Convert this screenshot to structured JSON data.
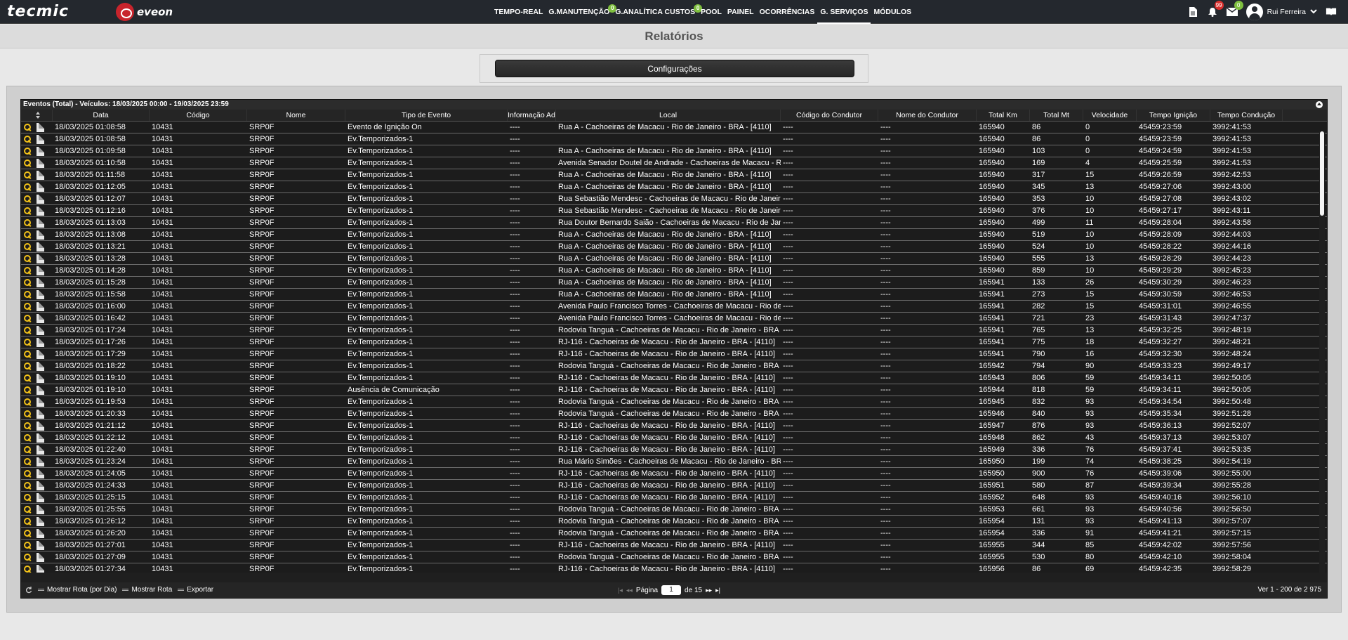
{
  "brand": {
    "tecmic": "tecmic",
    "eveon": "eveon"
  },
  "nav": [
    {
      "label": "TEMPO-REAL"
    },
    {
      "label": "G.MANUTENÇÃO",
      "badge": "0"
    },
    {
      "label": "G.ANALÍTICA CUSTOS",
      "badge": "0"
    },
    {
      "label": "POOL"
    },
    {
      "label": "PAINEL"
    },
    {
      "label": "OCORRÊNCIAS"
    },
    {
      "label": "G. SERVIÇOS",
      "active": true
    },
    {
      "label": "MÓDULOS"
    }
  ],
  "tools": {
    "alerts_badge": "99",
    "messages_badge": "0"
  },
  "user": {
    "name": "Rui Ferreira"
  },
  "page": {
    "title": "Relatórios",
    "config_button": "Configurações"
  },
  "grid": {
    "caption": "Eventos (Total) - Veículos: 18/03/2025 00:00 - 19/03/2025 23:59",
    "columns": [
      "Data",
      "Código",
      "Nome",
      "Tipo de Evento",
      "Informação Ad",
      "Local",
      "Código do Condutor",
      "Nome do Condutor",
      "Total Km",
      "Total Mt",
      "Velocidade",
      "Tempo Ignição",
      "Tempo Condução"
    ],
    "rows": [
      [
        "18/03/2025 01:08:58",
        "10431",
        "SRP0F",
        "Evento de Ignição On",
        "----",
        "Rua A - Cachoeiras de Macacu - Rio de Janeiro - BRA - [4110]",
        "----",
        "----",
        "165940",
        "86",
        "0",
        "45459:23:59",
        "3992:41:53"
      ],
      [
        "18/03/2025 01:08:58",
        "10431",
        "SRP0F",
        "Ev.Temporizados-1",
        "----",
        "",
        "----",
        "----",
        "165940",
        "86",
        "0",
        "45459:23:59",
        "3992:41:53"
      ],
      [
        "18/03/2025 01:09:58",
        "10431",
        "SRP0F",
        "Ev.Temporizados-1",
        "----",
        "Rua A - Cachoeiras de Macacu - Rio de Janeiro - BRA - [4110]",
        "----",
        "----",
        "165940",
        "103",
        "0",
        "45459:24:59",
        "3992:41:53"
      ],
      [
        "18/03/2025 01:10:58",
        "10431",
        "SRP0F",
        "Ev.Temporizados-1",
        "----",
        "Avenida Senador Doutel de Andrade - Cachoeiras de Macacu - Rio de Janeiro",
        "----",
        "----",
        "165940",
        "169",
        "4",
        "45459:25:59",
        "3992:41:53"
      ],
      [
        "18/03/2025 01:11:58",
        "10431",
        "SRP0F",
        "Ev.Temporizados-1",
        "----",
        "Rua A - Cachoeiras de Macacu - Rio de Janeiro - BRA - [4110]",
        "----",
        "----",
        "165940",
        "317",
        "15",
        "45459:26:59",
        "3992:42:53"
      ],
      [
        "18/03/2025 01:12:05",
        "10431",
        "SRP0F",
        "Ev.Temporizados-1",
        "----",
        "Rua A - Cachoeiras de Macacu - Rio de Janeiro - BRA - [4110]",
        "----",
        "----",
        "165940",
        "345",
        "13",
        "45459:27:06",
        "3992:43:00"
      ],
      [
        "18/03/2025 01:12:07",
        "10431",
        "SRP0F",
        "Ev.Temporizados-1",
        "----",
        "Rua Sebastião Mendesc - Cachoeiras de Macacu - Rio de Janeiro",
        "----",
        "----",
        "165940",
        "353",
        "10",
        "45459:27:08",
        "3992:43:02"
      ],
      [
        "18/03/2025 01:12:16",
        "10431",
        "SRP0F",
        "Ev.Temporizados-1",
        "----",
        "Rua Sebastião Mendesc - Cachoeiras de Macacu - Rio de Janeiro",
        "----",
        "----",
        "165940",
        "376",
        "10",
        "45459:27:17",
        "3992:43:11"
      ],
      [
        "18/03/2025 01:13:03",
        "10431",
        "SRP0F",
        "Ev.Temporizados-1",
        "----",
        "Rua Doutor Bernardo Saião - Cachoeiras de Macacu - Rio de Janeiro",
        "----",
        "----",
        "165940",
        "499",
        "11",
        "45459:28:04",
        "3992:43:58"
      ],
      [
        "18/03/2025 01:13:08",
        "10431",
        "SRP0F",
        "Ev.Temporizados-1",
        "----",
        "Rua A - Cachoeiras de Macacu - Rio de Janeiro - BRA - [4110]",
        "----",
        "----",
        "165940",
        "519",
        "10",
        "45459:28:09",
        "3992:44:03"
      ],
      [
        "18/03/2025 01:13:21",
        "10431",
        "SRP0F",
        "Ev.Temporizados-1",
        "----",
        "Rua A - Cachoeiras de Macacu - Rio de Janeiro - BRA - [4110]",
        "----",
        "----",
        "165940",
        "524",
        "10",
        "45459:28:22",
        "3992:44:16"
      ],
      [
        "18/03/2025 01:13:28",
        "10431",
        "SRP0F",
        "Ev.Temporizados-1",
        "----",
        "Rua A - Cachoeiras de Macacu - Rio de Janeiro - BRA - [4110]",
        "----",
        "----",
        "165940",
        "555",
        "13",
        "45459:28:29",
        "3992:44:23"
      ],
      [
        "18/03/2025 01:14:28",
        "10431",
        "SRP0F",
        "Ev.Temporizados-1",
        "----",
        "Rua A - Cachoeiras de Macacu - Rio de Janeiro - BRA - [4110]",
        "----",
        "----",
        "165940",
        "859",
        "10",
        "45459:29:29",
        "3992:45:23"
      ],
      [
        "18/03/2025 01:15:28",
        "10431",
        "SRP0F",
        "Ev.Temporizados-1",
        "----",
        "Rua A - Cachoeiras de Macacu - Rio de Janeiro - BRA - [4110]",
        "----",
        "----",
        "165941",
        "133",
        "26",
        "45459:30:29",
        "3992:46:23"
      ],
      [
        "18/03/2025 01:15:58",
        "10431",
        "SRP0F",
        "Ev.Temporizados-1",
        "----",
        "Rua A - Cachoeiras de Macacu - Rio de Janeiro - BRA - [4110]",
        "----",
        "----",
        "165941",
        "273",
        "15",
        "45459:30:59",
        "3992:46:53"
      ],
      [
        "18/03/2025 01:16:00",
        "10431",
        "SRP0F",
        "Ev.Temporizados-1",
        "----",
        "Avenida Paulo Francisco Torres - Cachoeiras de Macacu - Rio de Janeiro",
        "----",
        "----",
        "165941",
        "282",
        "15",
        "45459:31:01",
        "3992:46:55"
      ],
      [
        "18/03/2025 01:16:42",
        "10431",
        "SRP0F",
        "Ev.Temporizados-1",
        "----",
        "Avenida Paulo Francisco Torres - Cachoeiras de Macacu - Rio de Janeiro",
        "----",
        "----",
        "165941",
        "721",
        "23",
        "45459:31:43",
        "3992:47:37"
      ],
      [
        "18/03/2025 01:17:24",
        "10431",
        "SRP0F",
        "Ev.Temporizados-1",
        "----",
        "Rodovia Tanguá - Cachoeiras de Macacu - Rio de Janeiro - BRA",
        "----",
        "----",
        "165941",
        "765",
        "13",
        "45459:32:25",
        "3992:48:19"
      ],
      [
        "18/03/2025 01:17:26",
        "10431",
        "SRP0F",
        "Ev.Temporizados-1",
        "----",
        "RJ-116 - Cachoeiras de Macacu - Rio de Janeiro - BRA - [4110]",
        "----",
        "----",
        "165941",
        "775",
        "18",
        "45459:32:27",
        "3992:48:21"
      ],
      [
        "18/03/2025 01:17:29",
        "10431",
        "SRP0F",
        "Ev.Temporizados-1",
        "----",
        "RJ-116 - Cachoeiras de Macacu - Rio de Janeiro - BRA - [4110]",
        "----",
        "----",
        "165941",
        "790",
        "16",
        "45459:32:30",
        "3992:48:24"
      ],
      [
        "18/03/2025 01:18:22",
        "10431",
        "SRP0F",
        "Ev.Temporizados-1",
        "----",
        "Rodovia Tanguá - Cachoeiras de Macacu - Rio de Janeiro - BRA",
        "----",
        "----",
        "165942",
        "794",
        "90",
        "45459:33:23",
        "3992:49:17"
      ],
      [
        "18/03/2025 01:19:10",
        "10431",
        "SRP0F",
        "Ev.Temporizados-1",
        "----",
        "RJ-116 - Cachoeiras de Macacu - Rio de Janeiro - BRA - [4110]",
        "----",
        "----",
        "165943",
        "806",
        "59",
        "45459:34:11",
        "3992:50:05"
      ],
      [
        "18/03/2025 01:19:10",
        "10431",
        "SRP0F",
        "Ausência de Comunicação",
        "----",
        "RJ-116 - Cachoeiras de Macacu - Rio de Janeiro - BRA - [4110]",
        "----",
        "----",
        "165944",
        "818",
        "59",
        "45459:34:11",
        "3992:50:05"
      ],
      [
        "18/03/2025 01:19:53",
        "10431",
        "SRP0F",
        "Ev.Temporizados-1",
        "----",
        "Rodovia Tanguá - Cachoeiras de Macacu - Rio de Janeiro - BRA",
        "----",
        "----",
        "165945",
        "832",
        "93",
        "45459:34:54",
        "3992:50:48"
      ],
      [
        "18/03/2025 01:20:33",
        "10431",
        "SRP0F",
        "Ev.Temporizados-1",
        "----",
        "Rodovia Tanguá - Cachoeiras de Macacu - Rio de Janeiro - BRA",
        "----",
        "----",
        "165946",
        "840",
        "93",
        "45459:35:34",
        "3992:51:28"
      ],
      [
        "18/03/2025 01:21:12",
        "10431",
        "SRP0F",
        "Ev.Temporizados-1",
        "----",
        "RJ-116 - Cachoeiras de Macacu - Rio de Janeiro - BRA - [4110]",
        "----",
        "----",
        "165947",
        "876",
        "93",
        "45459:36:13",
        "3992:52:07"
      ],
      [
        "18/03/2025 01:22:12",
        "10431",
        "SRP0F",
        "Ev.Temporizados-1",
        "----",
        "RJ-116 - Cachoeiras de Macacu - Rio de Janeiro - BRA - [4110]",
        "----",
        "----",
        "165948",
        "862",
        "43",
        "45459:37:13",
        "3992:53:07"
      ],
      [
        "18/03/2025 01:22:40",
        "10431",
        "SRP0F",
        "Ev.Temporizados-1",
        "----",
        "RJ-116 - Cachoeiras de Macacu - Rio de Janeiro - BRA - [4110]",
        "----",
        "----",
        "165949",
        "336",
        "76",
        "45459:37:41",
        "3992:53:35"
      ],
      [
        "18/03/2025 01:23:24",
        "10431",
        "SRP0F",
        "Ev.Temporizados-1",
        "----",
        "Rua Mário Simões - Cachoeiras de Macacu - Rio de Janeiro - BRA",
        "----",
        "----",
        "165950",
        "199",
        "74",
        "45459:38:25",
        "3992:54:19"
      ],
      [
        "18/03/2025 01:24:05",
        "10431",
        "SRP0F",
        "Ev.Temporizados-1",
        "----",
        "RJ-116 - Cachoeiras de Macacu - Rio de Janeiro - BRA - [4110]",
        "----",
        "----",
        "165950",
        "900",
        "76",
        "45459:39:06",
        "3992:55:00"
      ],
      [
        "18/03/2025 01:24:33",
        "10431",
        "SRP0F",
        "Ev.Temporizados-1",
        "----",
        "RJ-116 - Cachoeiras de Macacu - Rio de Janeiro - BRA - [4110]",
        "----",
        "----",
        "165951",
        "580",
        "87",
        "45459:39:34",
        "3992:55:28"
      ],
      [
        "18/03/2025 01:25:15",
        "10431",
        "SRP0F",
        "Ev.Temporizados-1",
        "----",
        "RJ-116 - Cachoeiras de Macacu - Rio de Janeiro - BRA - [4110]",
        "----",
        "----",
        "165952",
        "648",
        "93",
        "45459:40:16",
        "3992:56:10"
      ],
      [
        "18/03/2025 01:25:55",
        "10431",
        "SRP0F",
        "Ev.Temporizados-1",
        "----",
        "Rodovia Tanguá - Cachoeiras de Macacu - Rio de Janeiro - BRA",
        "----",
        "----",
        "165953",
        "661",
        "93",
        "45459:40:56",
        "3992:56:50"
      ],
      [
        "18/03/2025 01:26:12",
        "10431",
        "SRP0F",
        "Ev.Temporizados-1",
        "----",
        "Rodovia Tanguá - Cachoeiras de Macacu - Rio de Janeiro - BRA",
        "----",
        "----",
        "165954",
        "131",
        "93",
        "45459:41:13",
        "3992:57:07"
      ],
      [
        "18/03/2025 01:26:20",
        "10431",
        "SRP0F",
        "Ev.Temporizados-1",
        "----",
        "Rodovia Tanguá - Cachoeiras de Macacu - Rio de Janeiro - BRA",
        "----",
        "----",
        "165954",
        "336",
        "91",
        "45459:41:21",
        "3992:57:15"
      ],
      [
        "18/03/2025 01:27:01",
        "10431",
        "SRP0F",
        "Ev.Temporizados-1",
        "----",
        "RJ-116 - Cachoeiras de Macacu - Rio de Janeiro - BRA - [4110]",
        "----",
        "----",
        "165955",
        "344",
        "85",
        "45459:42:02",
        "3992:57:56"
      ],
      [
        "18/03/2025 01:27:09",
        "10431",
        "SRP0F",
        "Ev.Temporizados-1",
        "----",
        "Rodovia Tanguá - Cachoeiras de Macacu - Rio de Janeiro - BRA",
        "----",
        "----",
        "165955",
        "530",
        "80",
        "45459:42:10",
        "3992:58:04"
      ],
      [
        "18/03/2025 01:27:34",
        "10431",
        "SRP0F",
        "Ev.Temporizados-1",
        "----",
        "RJ-116 - Cachoeiras de Macacu - Rio de Janeiro - BRA - [4110]",
        "----",
        "----",
        "165956",
        "86",
        "69",
        "45459:42:35",
        "3992:58:29"
      ]
    ]
  },
  "footer": {
    "show_route_day": "Mostrar Rota (por Dia)",
    "show_route": "Mostrar Rota",
    "export": "Exportar",
    "page_label": "Página",
    "page_value": "1",
    "page_of": "de 15",
    "range": "Ver 1 - 200 de 2 975"
  }
}
